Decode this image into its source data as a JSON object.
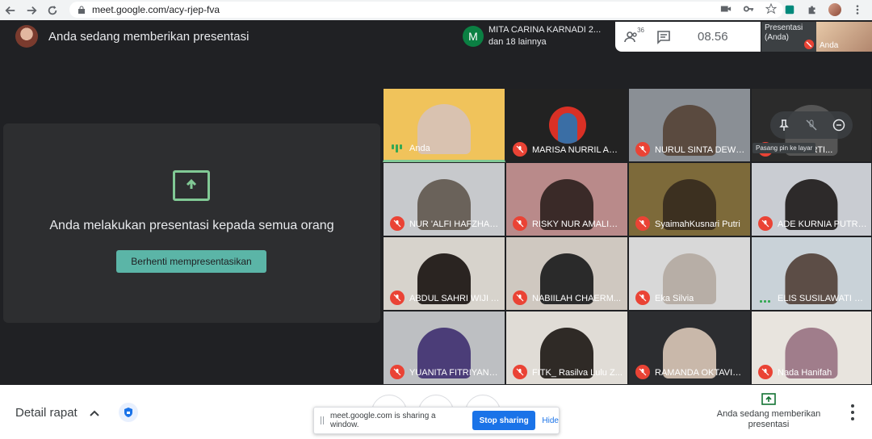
{
  "browser": {
    "url": "meet.google.com/acy-rjep-fva"
  },
  "header": {
    "title": "Anda sedang memberikan presentasi"
  },
  "chat_notice": {
    "avatar_letter": "M",
    "line1": "MITA CARINA KARNADI 2...",
    "line2": "dan 18 lainnya"
  },
  "meet_panel": {
    "participants_count": "36",
    "time": "08.56"
  },
  "self_view": {
    "label_line1": "Presentasi",
    "label_line2": "(Anda)",
    "name": "Anda"
  },
  "presentation": {
    "message": "Anda melakukan presentasi kepada semua orang",
    "stop_button": "Berhenti mempresentasikan"
  },
  "tiles": [
    {
      "name": "Anda",
      "state": "talking"
    },
    {
      "name": "MARISA NURRIL AM...",
      "state": "muted"
    },
    {
      "name": "NURUL SINTA DEWI ...",
      "state": "muted"
    },
    {
      "name": "TIKA PERTI...",
      "state": "muted"
    },
    {
      "name": "NUR 'ALFI HAFZHAN...",
      "state": "muted"
    },
    {
      "name": "RISKY NUR AMALIA ...",
      "state": "muted"
    },
    {
      "name": "SyaimahKusnari Putri",
      "state": "muted"
    },
    {
      "name": "ADE KURNIA PUTRI ...",
      "state": "muted"
    },
    {
      "name": "ABDUL SAHRI WIJI A...",
      "state": "muted"
    },
    {
      "name": "NABIILAH CHAERM...",
      "state": "muted"
    },
    {
      "name": "Eka Silvia",
      "state": "muted"
    },
    {
      "name": "ELIS SUSILAWATI 20...",
      "state": "talking-dots"
    },
    {
      "name": "YUANITA FITRIYANA ...",
      "state": "muted"
    },
    {
      "name": "FITK_ Rasilva Lulu Z...",
      "state": "muted"
    },
    {
      "name": "RAMANDA OKTAVIA...",
      "state": "muted"
    },
    {
      "name": "Nada Hanifah",
      "state": "muted"
    }
  ],
  "tooltip": "Pasang pin ke layar",
  "bottom": {
    "details": "Detail rapat",
    "present_label": "Anda sedang memberikan presentasi"
  },
  "sharebar": {
    "message": "meet.google.com is sharing a window.",
    "stop": "Stop sharing",
    "hide": "Hide"
  },
  "colors": {
    "background": "#202124",
    "accent": "#81c995",
    "stop_button": "#5bb5a7",
    "muted_red": "#ea4335",
    "chrome_blue": "#1a73e8"
  }
}
